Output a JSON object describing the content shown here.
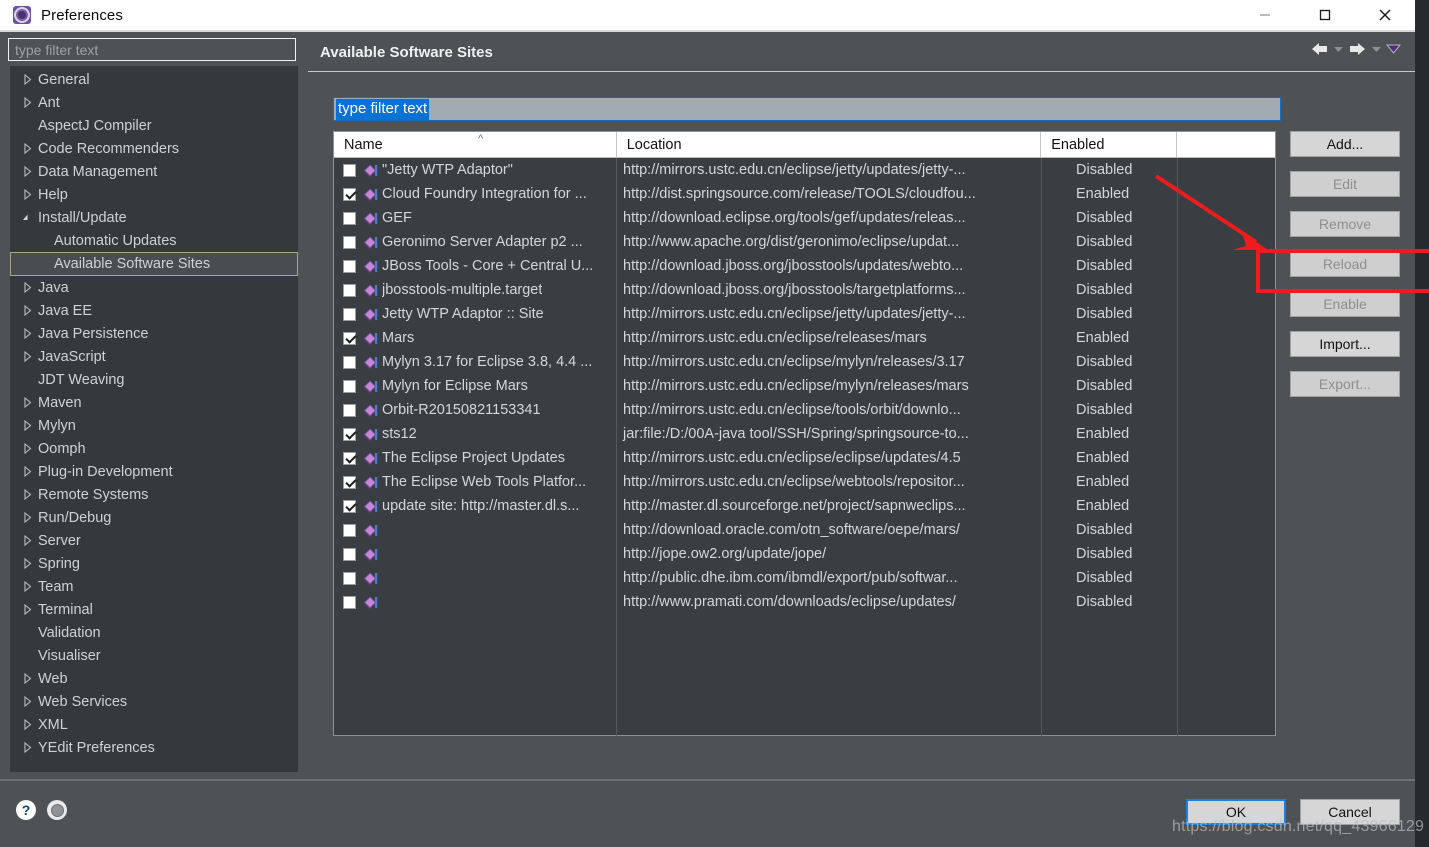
{
  "window": {
    "title": "Preferences",
    "icon": "preferences-gear-icon",
    "controls": {
      "minimize": "minimize-icon",
      "maximize": "maximize-icon",
      "close": "close-icon"
    }
  },
  "sidebar": {
    "filter_placeholder": "type filter text",
    "items": [
      {
        "label": "General",
        "arrow": "collapsed",
        "level": 0
      },
      {
        "label": "Ant",
        "arrow": "collapsed",
        "level": 0
      },
      {
        "label": "AspectJ Compiler",
        "arrow": "none",
        "level": 0
      },
      {
        "label": "Code Recommenders",
        "arrow": "collapsed",
        "level": 0
      },
      {
        "label": "Data Management",
        "arrow": "collapsed",
        "level": 0
      },
      {
        "label": "Help",
        "arrow": "collapsed",
        "level": 0
      },
      {
        "label": "Install/Update",
        "arrow": "expanded",
        "level": 0
      },
      {
        "label": "Automatic Updates",
        "arrow": "none",
        "level": 1
      },
      {
        "label": "Available Software Sites",
        "arrow": "none",
        "level": 1,
        "selected": true
      },
      {
        "label": "Java",
        "arrow": "collapsed",
        "level": 0
      },
      {
        "label": "Java EE",
        "arrow": "collapsed",
        "level": 0
      },
      {
        "label": "Java Persistence",
        "arrow": "collapsed",
        "level": 0
      },
      {
        "label": "JavaScript",
        "arrow": "collapsed",
        "level": 0
      },
      {
        "label": "JDT Weaving",
        "arrow": "none",
        "level": 0
      },
      {
        "label": "Maven",
        "arrow": "collapsed",
        "level": 0
      },
      {
        "label": "Mylyn",
        "arrow": "collapsed",
        "level": 0
      },
      {
        "label": "Oomph",
        "arrow": "collapsed",
        "level": 0
      },
      {
        "label": "Plug-in Development",
        "arrow": "collapsed",
        "level": 0
      },
      {
        "label": "Remote Systems",
        "arrow": "collapsed",
        "level": 0
      },
      {
        "label": "Run/Debug",
        "arrow": "collapsed",
        "level": 0
      },
      {
        "label": "Server",
        "arrow": "collapsed",
        "level": 0
      },
      {
        "label": "Spring",
        "arrow": "collapsed",
        "level": 0
      },
      {
        "label": "Team",
        "arrow": "collapsed",
        "level": 0
      },
      {
        "label": "Terminal",
        "arrow": "collapsed",
        "level": 0
      },
      {
        "label": "Validation",
        "arrow": "none",
        "level": 0
      },
      {
        "label": "Visualiser",
        "arrow": "none",
        "level": 0
      },
      {
        "label": "Web",
        "arrow": "collapsed",
        "level": 0
      },
      {
        "label": "Web Services",
        "arrow": "collapsed",
        "level": 0
      },
      {
        "label": "XML",
        "arrow": "collapsed",
        "level": 0
      },
      {
        "label": "YEdit Preferences",
        "arrow": "collapsed",
        "level": 0
      }
    ]
  },
  "page": {
    "title": "Available Software Sites",
    "nav": {
      "back": "back-arrow-icon",
      "back_menu": "chevron-down-icon",
      "forward": "forward-arrow-icon",
      "forward_menu": "chevron-down-icon",
      "view_menu": "view-menu-icon"
    },
    "filter": {
      "value": "type filter text",
      "selected": true
    }
  },
  "table": {
    "columns": [
      "Name",
      "Location",
      "Enabled"
    ],
    "sort_column": "Name",
    "sort_direction": "ascending",
    "rows": [
      {
        "checked": false,
        "name": "\"Jetty WTP Adaptor\"",
        "location": "http://mirrors.ustc.edu.cn/eclipse/jetty/updates/jetty-...",
        "enabled": "Disabled"
      },
      {
        "checked": true,
        "name": "Cloud Foundry Integration for ...",
        "location": "http://dist.springsource.com/release/TOOLS/cloudfou...",
        "enabled": "Enabled"
      },
      {
        "checked": false,
        "name": "GEF",
        "location": "http://download.eclipse.org/tools/gef/updates/releas...",
        "enabled": "Disabled"
      },
      {
        "checked": false,
        "name": "Geronimo Server Adapter p2 ...",
        "location": "http://www.apache.org/dist/geronimo/eclipse/updat...",
        "enabled": "Disabled"
      },
      {
        "checked": false,
        "name": "JBoss Tools - Core + Central U...",
        "location": "http://download.jboss.org/jbosstools/updates/webto...",
        "enabled": "Disabled"
      },
      {
        "checked": false,
        "name": "jbosstools-multiple.target",
        "location": "http://download.jboss.org/jbosstools/targetplatforms...",
        "enabled": "Disabled"
      },
      {
        "checked": false,
        "name": "Jetty WTP Adaptor :: Site",
        "location": "http://mirrors.ustc.edu.cn/eclipse/jetty/updates/jetty-...",
        "enabled": "Disabled"
      },
      {
        "checked": true,
        "name": "Mars",
        "location": "http://mirrors.ustc.edu.cn/eclipse/releases/mars",
        "enabled": "Enabled"
      },
      {
        "checked": false,
        "name": "Mylyn 3.17 for Eclipse 3.8, 4.4 ...",
        "location": "http://mirrors.ustc.edu.cn/eclipse/mylyn/releases/3.17",
        "enabled": "Disabled"
      },
      {
        "checked": false,
        "name": "Mylyn for Eclipse Mars",
        "location": "http://mirrors.ustc.edu.cn/eclipse/mylyn/releases/mars",
        "enabled": "Disabled"
      },
      {
        "checked": false,
        "name": "Orbit-R20150821153341",
        "location": "http://mirrors.ustc.edu.cn/eclipse/tools/orbit/downlo...",
        "enabled": "Disabled"
      },
      {
        "checked": true,
        "name": "sts12",
        "location": "jar:file:/D:/00A-java tool/SSH/Spring/springsource-to...",
        "enabled": "Enabled"
      },
      {
        "checked": true,
        "name": "The Eclipse Project Updates",
        "location": "http://mirrors.ustc.edu.cn/eclipse/eclipse/updates/4.5",
        "enabled": "Enabled"
      },
      {
        "checked": true,
        "name": "The Eclipse Web Tools Platfor...",
        "location": "http://mirrors.ustc.edu.cn/eclipse/webtools/repositor...",
        "enabled": "Enabled"
      },
      {
        "checked": true,
        "name": "update site: http://master.dl.s...",
        "location": "http://master.dl.sourceforge.net/project/sapnweclips...",
        "enabled": "Enabled"
      },
      {
        "checked": false,
        "name": "",
        "location": "http://download.oracle.com/otn_software/oepe/mars/",
        "enabled": "Disabled"
      },
      {
        "checked": false,
        "name": "",
        "location": "http://jope.ow2.org/update/jope/",
        "enabled": "Disabled"
      },
      {
        "checked": false,
        "name": "",
        "location": "http://public.dhe.ibm.com/ibmdl/export/pub/softwar...",
        "enabled": "Disabled"
      },
      {
        "checked": false,
        "name": "",
        "location": "http://www.pramati.com/downloads/eclipse/updates/",
        "enabled": "Disabled"
      }
    ]
  },
  "buttons": [
    {
      "label": "Add...",
      "enabled": true
    },
    {
      "label": "Edit",
      "enabled": false
    },
    {
      "label": "Remove",
      "enabled": false
    },
    {
      "label": "Reload",
      "enabled": false,
      "highlighted": true
    },
    {
      "label": "Enable",
      "enabled": false
    },
    {
      "label": "Import...",
      "enabled": true
    },
    {
      "label": "Export...",
      "enabled": false
    }
  ],
  "footer": {
    "help_icon": "question-mark-icon",
    "settings_icon": "gear-icon",
    "ok_label": "OK",
    "cancel_label": "Cancel",
    "watermark": "https://blog.csdn.net/qq_43966129"
  },
  "annotation": {
    "color": "#ee1c1c",
    "target": "Reload",
    "shapes": [
      "arrow",
      "rectangle"
    ]
  }
}
